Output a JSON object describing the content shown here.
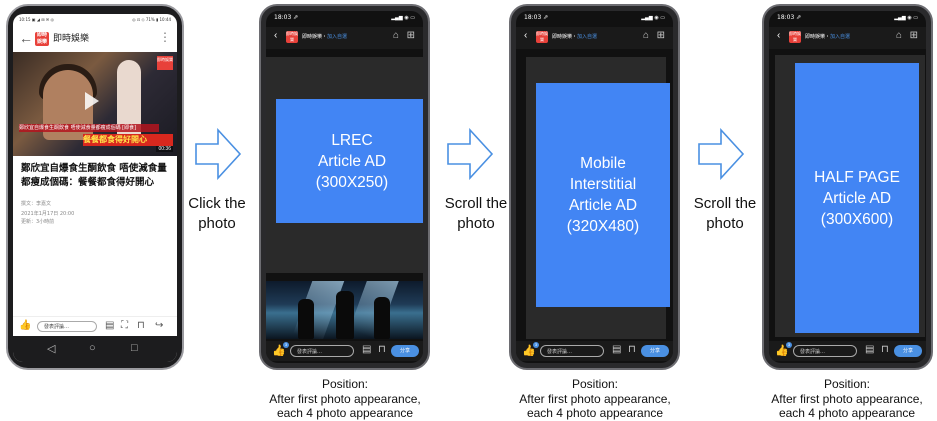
{
  "phone1": {
    "status_left": "10:15 ▣ ◢ ⊞ ✉ ◎",
    "status_right": "◎ ⊡ ◇ 71% ▮ 10:44",
    "back": "←",
    "logo": "即時娛樂",
    "title": "即時娛樂",
    "menu": "⋮",
    "badge": "即時娛樂",
    "subtitle_banner": "鄭欣宜自爆食生酮飲食 唔使減食量都瘦成個碼 [即食]",
    "subtitle_highlight": "餐餐都食得好開心",
    "video_time": "00:36",
    "headline": "鄭欣宜自爆食生酮飲食 唔使減食量都瘦成個碼：餐餐都食得好開心",
    "author": "撰文：李嘉文",
    "date": "2021年1月17日 20:00",
    "updated": "更新：3小時前",
    "comment_placeholder": "發表評論…",
    "nav": [
      "◁",
      "○",
      "□"
    ]
  },
  "phones": [
    {
      "time": "18:03 ⇗",
      "signal": "▂▄▆ ◉ ▭",
      "title_name": "即時娛樂",
      "title_sep": "・",
      "title_join": "加入自選",
      "ad_lines": [
        "LREC",
        "Article AD",
        "(300X250)"
      ],
      "like_count": "3",
      "comment_placeholder": "發表評論…",
      "share": "分享",
      "position_lines": [
        "Position:",
        "After first photo appearance,",
        "each 4 photo appearance"
      ]
    },
    {
      "time": "18:03 ⇗",
      "signal": "▂▄▆ ◉ ▭",
      "title_name": "即時娛樂",
      "title_sep": "・",
      "title_join": "加入自選",
      "ad_lines": [
        "Mobile",
        "Interstitial",
        "Article AD",
        "(320X480)"
      ],
      "like_count": "3",
      "comment_placeholder": "發表評論…",
      "share": "分享",
      "position_lines": [
        "Position:",
        "After first photo appearance,",
        "each 4 photo appearance"
      ]
    },
    {
      "time": "18:03 ⇗",
      "signal": "▂▄▆ ◉ ▭",
      "title_name": "即時娛樂",
      "title_sep": "・",
      "title_join": "加入自選",
      "ad_lines": [
        "HALF PAGE",
        "Article AD",
        "(300X600)"
      ],
      "like_count": "3",
      "comment_placeholder": "發表評論…",
      "share": "分享",
      "position_lines": [
        "Position:",
        "After first photo appearance,",
        "each 4 photo appearance"
      ]
    }
  ],
  "steps": [
    {
      "lines": [
        "Click the",
        "photo"
      ]
    },
    {
      "lines": [
        "Scroll the",
        "photo"
      ]
    },
    {
      "lines": [
        "Scroll the",
        "photo"
      ]
    }
  ],
  "colors": {
    "ad_blue": "#4285f4",
    "brand_red": "#e8413a",
    "link_blue": "#4a90e2"
  }
}
